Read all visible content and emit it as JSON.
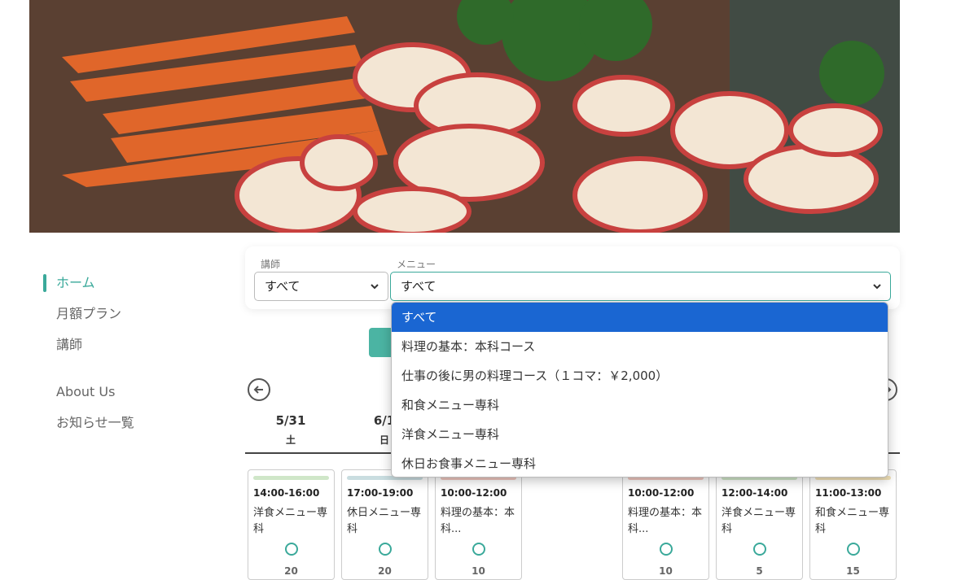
{
  "sidebar": {
    "items": [
      {
        "label": "ホーム"
      },
      {
        "label": "月額プラン"
      },
      {
        "label": "講師"
      },
      {
        "label": "About Us"
      },
      {
        "label": "お知らせ一覧"
      }
    ]
  },
  "filters": {
    "teacher_label": "講師",
    "teacher_value": "すべて",
    "menu_label": "メニュー",
    "menu_value": "すべて"
  },
  "dropdown": {
    "options": [
      "すべて",
      "料理の基本：本科コース",
      "仕事の後に男の料理コース（１コマ：￥2,000）",
      "和食メニュー専科",
      "洋食メニュー専科",
      "休日お食事メニュー専科"
    ]
  },
  "dates": [
    {
      "date": "5/31",
      "weekday": "土"
    },
    {
      "date": "6/1",
      "weekday": "日"
    }
  ],
  "lessons": [
    {
      "time": "14:00-16:00",
      "title": "洋食メニュー専科",
      "seats": "20",
      "color": "#cfe6c8"
    },
    {
      "time": "17:00-19:00",
      "title": "休日メニュー専科",
      "seats": "20",
      "color": "#c9dde0"
    },
    {
      "time": "10:00-12:00",
      "title": "料理の基本：本科...",
      "seats": "10",
      "color": "#f0c8c0"
    },
    {
      "time": "10:00-12:00",
      "title": "料理の基本：本科...",
      "seats": "10",
      "color": "#f0c8c0"
    },
    {
      "time": "12:00-14:00",
      "title": "洋食メニュー専科",
      "seats": "5",
      "color": "#cfe6c8"
    },
    {
      "time": "11:00-13:00",
      "title": "和食メニュー専科",
      "seats": "15",
      "color": "#f2e2b8"
    }
  ],
  "colors": {
    "accent": "#3aa99a",
    "selected": "#1a66d2"
  }
}
